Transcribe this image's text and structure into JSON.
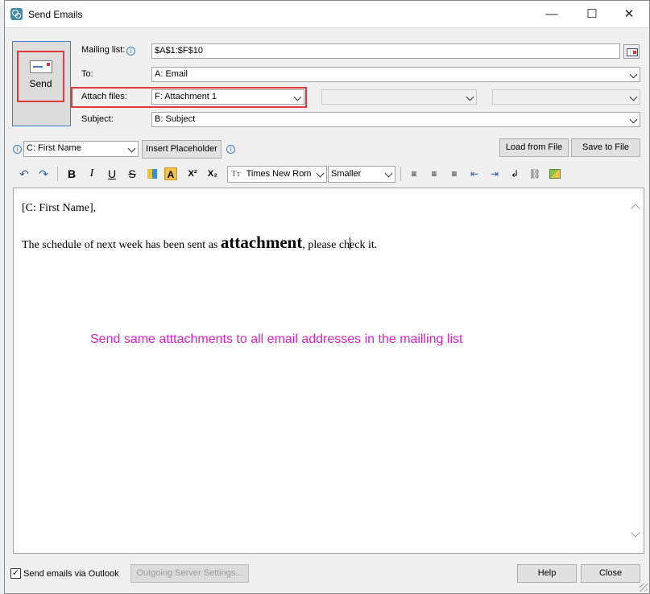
{
  "window": {
    "title": "Send Emails",
    "minimize": "—",
    "maximize": "☐",
    "close": "✕"
  },
  "send": {
    "label": "Send"
  },
  "mailing_list": {
    "label": "Mailing list:",
    "value": "$A$1:$F$10"
  },
  "to": {
    "label": "To:",
    "value": "A: Email"
  },
  "attach": {
    "label": "Attach files:",
    "value": "F: Attachment 1",
    "extra1": "",
    "extra2": ""
  },
  "subject": {
    "label": "Subject:",
    "value": "B: Subject"
  },
  "placeholder": {
    "field_value": "C: First Name",
    "insert_label": "Insert Placeholder"
  },
  "file_buttons": {
    "load": "Load from File",
    "save": "Save to File"
  },
  "toolbar": {
    "undo": "↶",
    "redo": "↷",
    "bold": "B",
    "italic": "I",
    "underline": "U",
    "strike": "S",
    "fore_color": "A",
    "superscript": "X²",
    "subscript": "X₂",
    "font_icon": "Tт",
    "font_name": "Times New Rom",
    "font_size": "Smaller"
  },
  "body": {
    "line1": "[C: First Name],",
    "line2_before": "The schedule of next week has been sent as ",
    "line2_big": "attachment",
    "line2_after_a": ", please ch",
    "line2_after_b": "eck it."
  },
  "annotation": "Send same atttachments to all email addresses in the mailling list",
  "footer": {
    "outlook_label": "Send emails via Outlook",
    "outlook_checked": "✓",
    "server_settings": "Outgoing Server Settings...",
    "help": "Help",
    "close": "Close"
  },
  "colors": {
    "accent": "#3c7fc4",
    "highlight_red": "#e23a3a",
    "annotation": "#e020c8"
  }
}
